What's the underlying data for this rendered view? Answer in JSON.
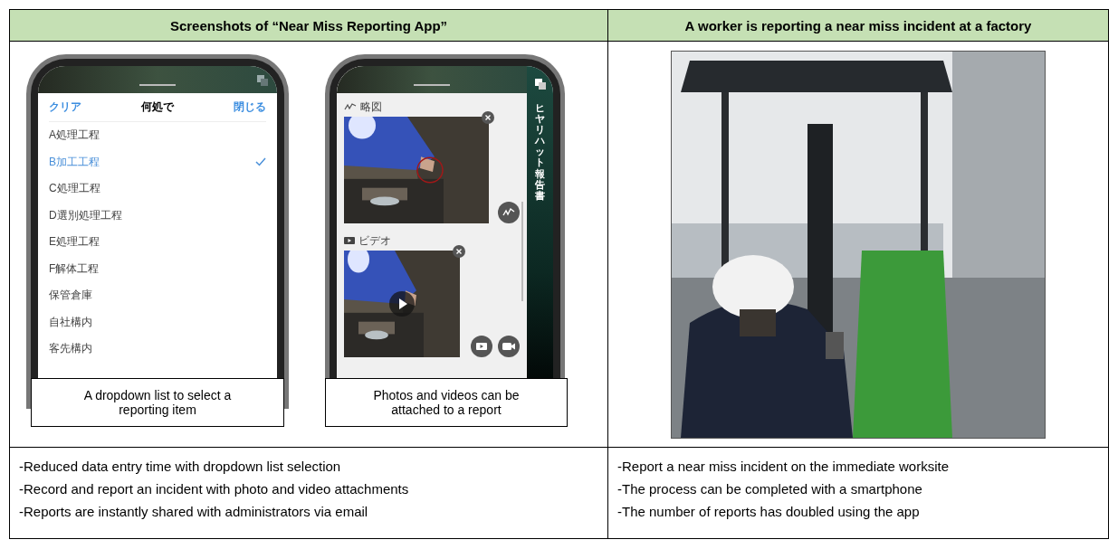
{
  "headers": [
    "Screenshots of “Near Miss Reporting App”",
    "A worker is reporting a near miss incident at a factory"
  ],
  "phones": [
    {
      "kind": "dropdown",
      "clear": "クリア",
      "title": "何処で",
      "close": "閉じる",
      "options": [
        {
          "label": "A処理工程",
          "selected": false
        },
        {
          "label": "B加工工程",
          "selected": true
        },
        {
          "label": "C処理工程",
          "selected": false
        },
        {
          "label": "D選別処理工程",
          "selected": false
        },
        {
          "label": "E処理工程",
          "selected": false
        },
        {
          "label": "F解体工程",
          "selected": false
        },
        {
          "label": "保管倉庫",
          "selected": false
        },
        {
          "label": "自社構内",
          "selected": false
        },
        {
          "label": "客先構内",
          "selected": false
        }
      ],
      "caption": "A dropdown list to select a reporting item"
    },
    {
      "kind": "attachments",
      "side_title": "ヒヤリハット報告書",
      "sections": [
        {
          "kind": "sketch",
          "label": "略図"
        },
        {
          "kind": "video",
          "label": "ビデオ"
        }
      ],
      "caption": "Photos and videos can be attached to a report"
    }
  ],
  "photo": {
    "kind": "picture"
  },
  "left_notes": [
    "-Reduced data entry time with dropdown list selection",
    "-Record and report an incident with photo and video attachments",
    "-Reports are instantly shared with administrators via email"
  ],
  "right_notes": [
    "-Report a near miss incident on the immediate worksite",
    "-The process can be completed with a smartphone",
    "-The number of reports has doubled using the app"
  ]
}
